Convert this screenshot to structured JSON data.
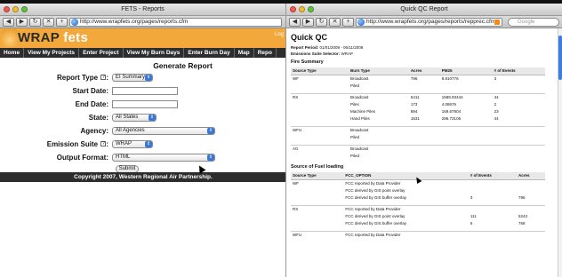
{
  "left_window": {
    "title": "FETS - Reports",
    "url": "http://www.wrapfets.org/pages/reports.cfm",
    "brand": {
      "wrap": "WRAP",
      "fets": "fets"
    },
    "login_text": "Log",
    "nav": [
      "Home",
      "View My Projects",
      "Enter Project",
      "View My Burn Days",
      "Enter Burn Day",
      "Map",
      "Repo"
    ],
    "form": {
      "title": "Generate Report",
      "report_type_label": "Report Type",
      "report_type_value": "EI Summary",
      "start_date_label": "Start Date:",
      "end_date_label": "End Date:",
      "state_label": "State:",
      "state_value": "All States",
      "agency_label": "Agency:",
      "agency_value": "All Agencies",
      "emission_suite_label": "Emission Suite",
      "emission_suite_value": "WRAP",
      "output_format_label": "Output Format:",
      "output_format_value": "HTML",
      "submit_label": "Submit"
    },
    "footer": "Copyright 2007, Western Regional Air Partnership."
  },
  "right_window": {
    "title": "Quick QC Report",
    "url": "http://www.wrapfets.org/pages/reports/repprec.cfm",
    "search_placeholder": "Google",
    "heading": "Quick QC",
    "report_period_label": "Report Period:",
    "report_period_value": "01/01/2009 - 06/11/2009",
    "emission_suite_label": "Emissions Suite Selector:",
    "emission_suite_value": "WRAP",
    "fire_summary": {
      "title": "Fire Summary",
      "headers": [
        "Source Type",
        "Burn Type",
        "Acres",
        "PM25",
        "# of Events"
      ],
      "rows": [
        [
          "WF",
          "Broadcast",
          "796",
          "8.810776",
          "3"
        ],
        [
          "",
          "Piled",
          "",
          "",
          ""
        ],
        [
          "",
          "",
          "",
          "",
          ""
        ],
        [
          "RX",
          "Broadcast",
          "5411",
          "1589.93444",
          "44"
        ],
        [
          "",
          "Piles",
          "173",
          "4.08676",
          "2"
        ],
        [
          "",
          "Machine Piles",
          "894",
          "169.67804",
          "23"
        ],
        [
          "",
          "Hand Piles",
          "1531",
          "286.73105",
          "44"
        ],
        [
          "",
          "",
          "",
          "",
          ""
        ],
        [
          "WFU",
          "Broadcast",
          "",
          "",
          ""
        ],
        [
          "",
          "Piled",
          "",
          "",
          ""
        ],
        [
          "",
          "",
          "",
          "",
          ""
        ],
        [
          "AG",
          "Broadcast",
          "",
          "",
          ""
        ],
        [
          "",
          "Piled",
          "",
          "",
          ""
        ]
      ]
    },
    "fuel_loading": {
      "title": "Source of Fuel loading",
      "headers": [
        "Source Type",
        "FCC_OPTION",
        "# of Events",
        "Acres"
      ],
      "rows": [
        [
          "WF",
          "FCC reported by Data Provider",
          "",
          ""
        ],
        [
          "",
          "FCC derived by GIS point overlay",
          "",
          ""
        ],
        [
          "",
          "FCC derived by GIS buffer overlay",
          "3",
          "796"
        ],
        [
          "",
          "",
          "",
          ""
        ],
        [
          "RX",
          "FCC reported by Data Provider",
          "",
          ""
        ],
        [
          "",
          "FCC derived by GIS point overlay",
          "111",
          "5243"
        ],
        [
          "",
          "FCC derived by GIS buffer overlay",
          "6",
          "768"
        ],
        [
          "",
          "",
          "",
          ""
        ],
        [
          "WFU",
          "FCC reported by Data Provider",
          "",
          ""
        ]
      ]
    }
  }
}
